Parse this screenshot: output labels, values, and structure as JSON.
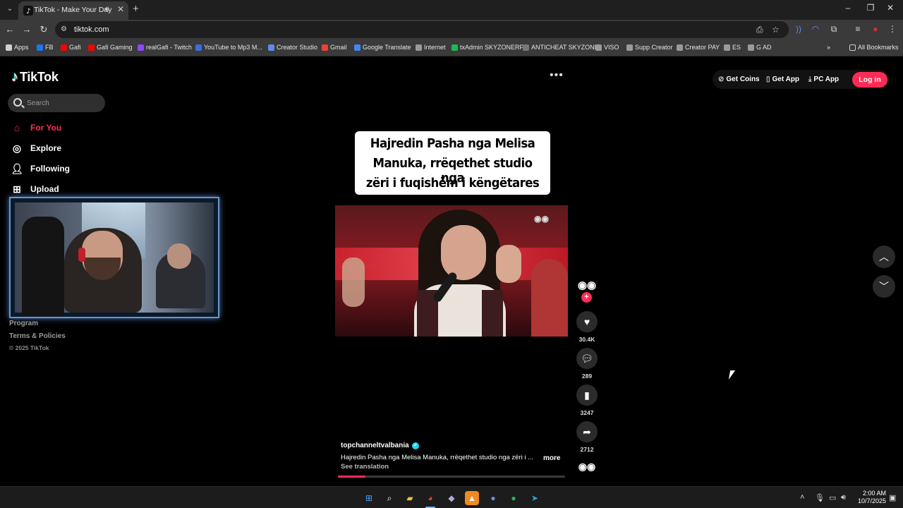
{
  "browser": {
    "tab_title": "TikTok - Make Your Day",
    "url": "tiktok.com",
    "bookmarks": [
      {
        "label": "Apps",
        "color": "#cfcfcf"
      },
      {
        "label": "FB",
        "color": "#1877f2"
      },
      {
        "label": "Gafi",
        "color": "#ff0000"
      },
      {
        "label": "Gafi Gaming",
        "color": "#ff0000"
      },
      {
        "label": "realGafi - Twitch",
        "color": "#9146ff"
      },
      {
        "label": "YouTube to Mp3 M...",
        "color": "#3b6de0"
      },
      {
        "label": "Creator Studio",
        "color": "#5b8de8"
      },
      {
        "label": "Gmail",
        "color": "#ea4335"
      },
      {
        "label": "Google Translate",
        "color": "#4285f4"
      },
      {
        "label": "Internet",
        "color": "#9a9a9a"
      },
      {
        "label": "txAdmin SKYZONERP",
        "color": "#1db954"
      },
      {
        "label": "ANTICHEAT SKYZONE",
        "color": "#777"
      },
      {
        "label": "VISO",
        "color": "#9a9a9a"
      },
      {
        "label": "Supp Creator",
        "color": "#9a9a9a"
      },
      {
        "label": "Creator PAY",
        "color": "#9a9a9a"
      },
      {
        "label": "ES",
        "color": "#9a9a9a"
      },
      {
        "label": "G AD",
        "color": "#9a9a9a"
      }
    ],
    "all_bookmarks": "All Bookmarks"
  },
  "tiktok": {
    "logo": "TikTok",
    "search_placeholder": "Search",
    "nav": [
      {
        "label": "For You",
        "icon": "home-icon"
      },
      {
        "label": "Explore",
        "icon": "compass-icon"
      },
      {
        "label": "Following",
        "icon": "following-icon"
      },
      {
        "label": "Upload",
        "icon": "upload-icon"
      }
    ],
    "footer": {
      "program": "Program",
      "terms": "Terms & Policies",
      "copyright": "© 2025 TikTok"
    },
    "header": {
      "get_coins": "Get Coins",
      "get_app": "Get App",
      "pc_app": "PC App",
      "login": "Log in"
    },
    "video": {
      "title_lines": [
        "Hajredin Pasha nga Melisa",
        "Manuka, rrëqethet studio nga",
        "zëri i fuqishëm i këngëtares"
      ],
      "username": "topchanneltvalbania",
      "caption": "Hajredin Pasha nga Melisa Manuka, rrëqethet studio nga zëri i ...",
      "more": "more",
      "see_translation": "See translation",
      "likes": "30.4K",
      "comments": "289",
      "saves": "3247",
      "shares": "2712",
      "progress_percent": 12
    }
  },
  "taskbar": {
    "time": "2:00 AM",
    "date": "10/7/2025"
  }
}
